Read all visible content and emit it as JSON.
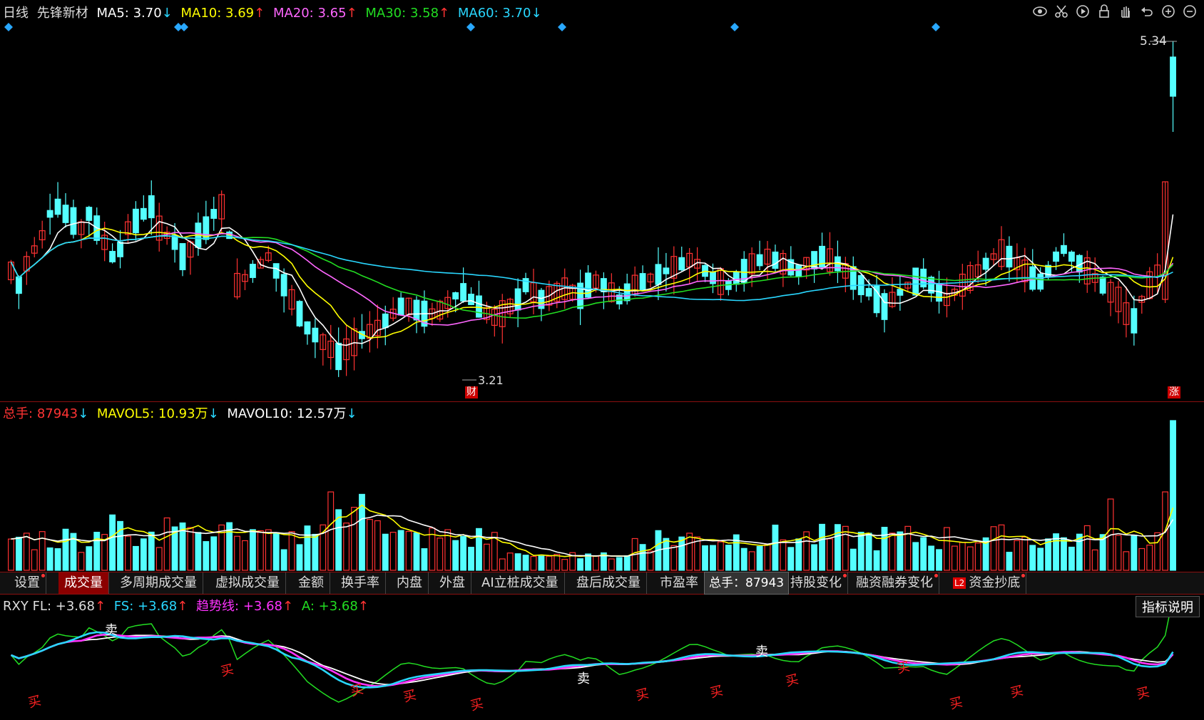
{
  "main": {
    "period": "日线",
    "stock_name": "先锋新材",
    "ma": [
      {
        "label": "MA5:",
        "value": "3.70",
        "arrow": "↓",
        "color": "#ffffff",
        "arrow_color": "#29d7ff"
      },
      {
        "label": "MA10:",
        "value": "3.69",
        "arrow": "↑",
        "color": "#ffff00",
        "arrow_color": "#ff3333"
      },
      {
        "label": "MA20:",
        "value": "3.65",
        "arrow": "↑",
        "color": "#ff66ff",
        "arrow_color": "#ff3333"
      },
      {
        "label": "MA30:",
        "value": "3.58",
        "arrow": "↑",
        "color": "#22dd22",
        "arrow_color": "#ff3333"
      },
      {
        "label": "MA60:",
        "value": "3.70",
        "arrow": "↓",
        "color": "#29d7ff",
        "arrow_color": "#29d7ff"
      }
    ],
    "high_label": "5.34",
    "low_label": "3.21",
    "badge_finance": "财",
    "badge_limit": "涨"
  },
  "volume": {
    "label_total": "总手:",
    "total_value": "87943",
    "total_arrow": "↓",
    "mavol5_label": "MAVOL5:",
    "mavol5_value": "10.93万",
    "mavol5_arrow": "↓",
    "mavol10_label": "MAVOL10:",
    "mavol10_value": "12.57万",
    "mavol10_arrow": "↓"
  },
  "tabs": [
    {
      "label": "设置",
      "dot": true
    },
    {
      "label": "成交量",
      "active": true
    },
    {
      "label": "多周期成交量"
    },
    {
      "label": "虚拟成交量"
    },
    {
      "label": "金额"
    },
    {
      "label": "换手率"
    },
    {
      "label": "内盘"
    },
    {
      "label": "外盘"
    },
    {
      "label": "AI立桩成交量"
    },
    {
      "label": "盘后成交量"
    },
    {
      "label": "市盈率"
    },
    {
      "label": "持股变化",
      "dot": true
    },
    {
      "label": "融资融券变化",
      "dot": true
    },
    {
      "label": "资金抄底",
      "dot": true,
      "l2": true
    }
  ],
  "tooltip": "总手：87943",
  "indicator": {
    "name": "RXY",
    "fl_label": "FL:",
    "fl_value": "+3.68",
    "fs_label": "FS:",
    "fs_value": "+3.68",
    "trend_label": "趋势线:",
    "trend_value": "+3.68",
    "a_label": "A:",
    "a_value": "+3.68",
    "arrow": "↑",
    "help": "指标说明",
    "buy": "买",
    "sell": "卖"
  },
  "colors": {
    "up": "#ff3232",
    "down": "#54ffff",
    "ma5": "#ffffff",
    "ma10": "#ffff00",
    "ma20": "#ff66ff",
    "ma30": "#22dd22",
    "ma60": "#29d7ff"
  },
  "icons": [
    "eye-icon",
    "scissors-icon",
    "play-icon",
    "lock-icon",
    "hand-icon",
    "undo-icon",
    "zoom-in-icon",
    "zoom-out-icon"
  ]
}
